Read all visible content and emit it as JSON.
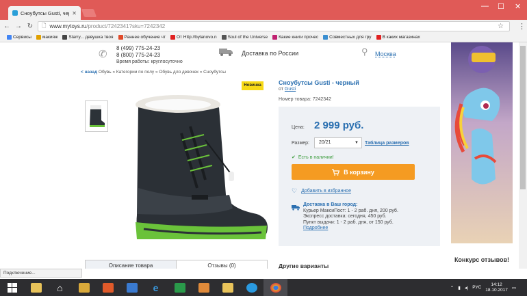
{
  "browser": {
    "tab_title": "Сноубутсы Gusti, черн",
    "url_host": "www.mytoys.ru",
    "url_path": "/product/7242341?sku=7242342"
  },
  "bookmarks": [
    {
      "label": "Сервисы",
      "color": "#4285f4"
    },
    {
      "label": "макияж",
      "color": "#e0a000"
    },
    {
      "label": "Starry... девушка твоя",
      "color": "#444"
    },
    {
      "label": "Раннее обучение чт",
      "color": "#e04a2a"
    },
    {
      "label": "От Http://bylanovo.n",
      "color": "#e02020"
    },
    {
      "label": "Soul of the Universe",
      "color": "#555"
    },
    {
      "label": "Какие книги прочес",
      "color": "#c02070"
    },
    {
      "label": "Совместных для гру",
      "color": "#3a8ed0"
    },
    {
      "label": "В каких магазинах",
      "color": "#e02020"
    }
  ],
  "header": {
    "phone1": "8 (499) 775-24-23",
    "phone2": "8 (800) 775-24-23",
    "hours": "Время работы: круглосуточно",
    "delivery": "Доставка по России",
    "city": "Москва"
  },
  "breadcrumbs": {
    "back": "< назад",
    "path": "Обувь » Категории по полу » Обувь для девочек » Сноубутсы"
  },
  "product": {
    "badge": "Новинка",
    "title": "Сноубутсы Gusti - черный",
    "brand_prefix": "от",
    "brand": "Gusti",
    "sku": "Номер товара: 7242342",
    "price_label": "Цена:",
    "price": "2 999 руб.",
    "size_label": "Размер:",
    "size_value": "20/21",
    "size_table": "Таблица размеров",
    "stock": "Есть в наличии!",
    "cart_button": "В корзину",
    "favorites": "Добавить в избранное",
    "shipping_title": "Доставка в Ваш город:",
    "shipping_lines": [
      "Курьер МаксиПост: 1 - 2 раб. дня, 200 руб.",
      "Экспресс доставка: сегодня, 450 руб.",
      "Пункт выдачи: 1 - 2 раб. дня, от 150 руб."
    ],
    "shipping_more": "Подробнее"
  },
  "tabs": {
    "description": "Описание товара",
    "reviews": "Отзывы (0)"
  },
  "other_variants": "Другие варианты",
  "ad": {
    "text": "Конкурс отзывов!"
  },
  "status_bar": "Подключение...",
  "taskbar": {
    "lang": "РУС",
    "time": "14:12",
    "date": "18.10.2017"
  }
}
